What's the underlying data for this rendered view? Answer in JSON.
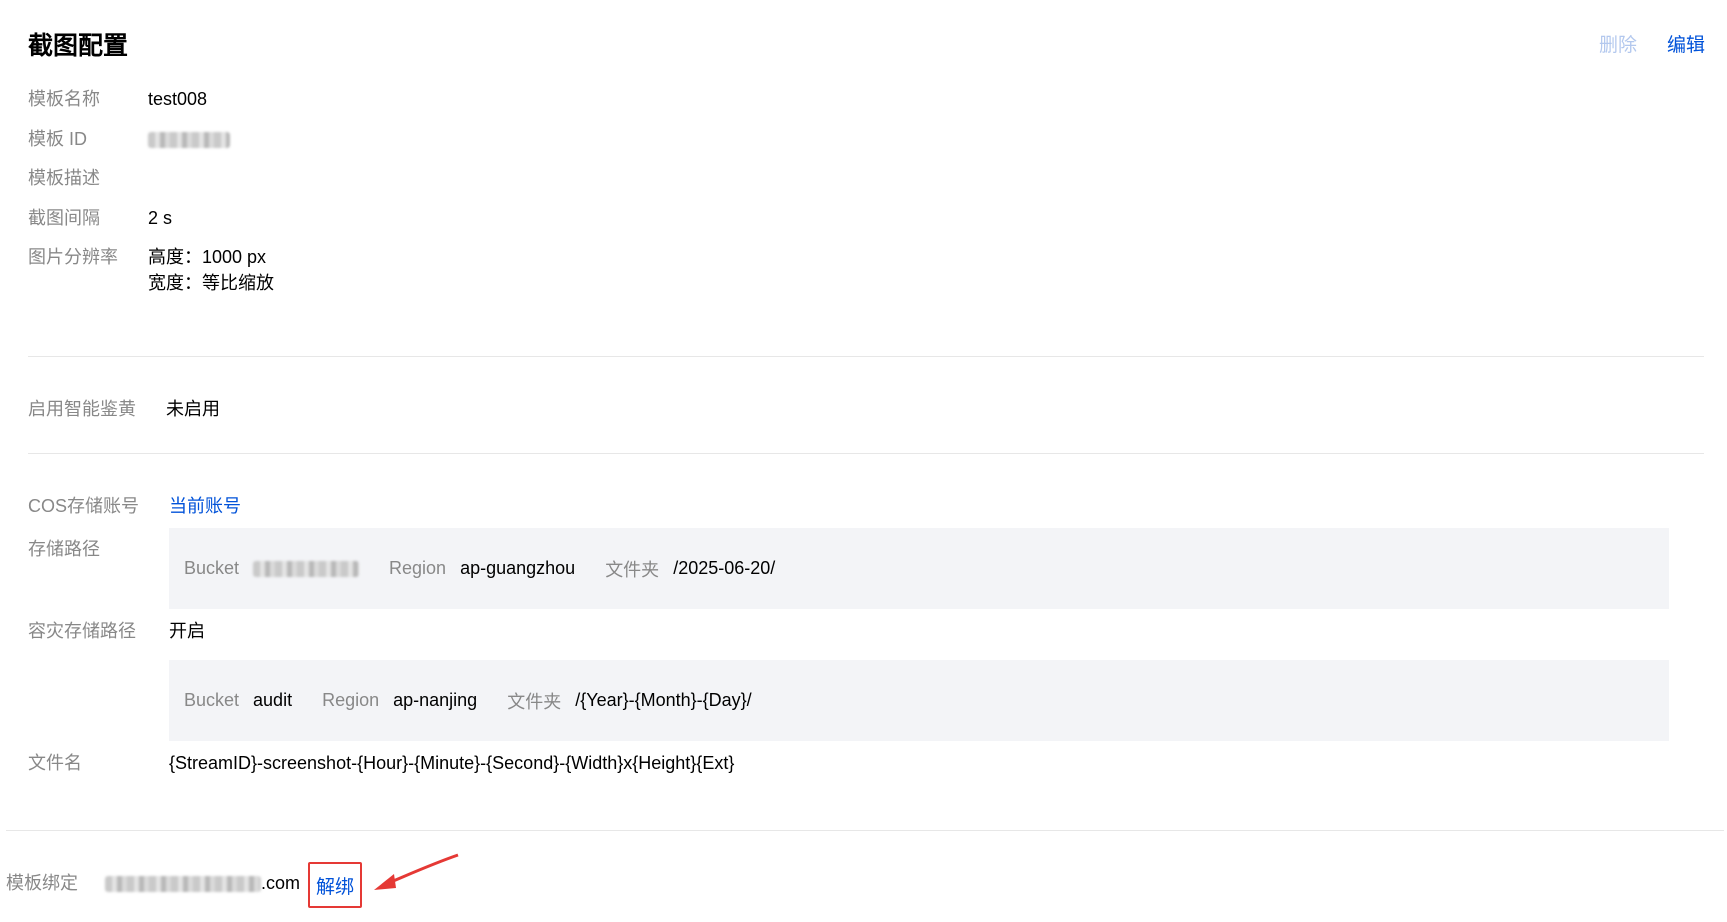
{
  "header": {
    "title": "截图配置",
    "delete_label": "删除",
    "edit_label": "编辑"
  },
  "template": {
    "name_label": "模板名称",
    "name_value": "test008",
    "id_label": "模板 ID",
    "desc_label": "模板描述",
    "desc_value": "",
    "interval_label": "截图间隔",
    "interval_value": "2 s",
    "resolution_label": "图片分辨率",
    "resolution_height": "高度：1000 px",
    "resolution_width": "宽度：等比缩放"
  },
  "porn_detect": {
    "label": "启用智能鉴黄",
    "value": "未启用"
  },
  "storage": {
    "cos_label": "COS存储账号",
    "cos_value": "当前账号",
    "path_label": "存储路径",
    "primary": {
      "bucket_label": "Bucket",
      "region_label": "Region",
      "region_value": "ap-guangzhou",
      "folder_label": "文件夹",
      "folder_value": "/2025-06-20/"
    },
    "backup_label": "容灾存储路径",
    "backup_value": "开启",
    "backup": {
      "bucket_label": "Bucket",
      "bucket_value": "audit",
      "region_label": "Region",
      "region_value": "ap-nanjing",
      "folder_label": "文件夹",
      "folder_value": "/{Year}-{Month}-{Day}/"
    },
    "filename_label": "文件名",
    "filename_value": "{StreamID}-screenshot-{Hour}-{Minute}-{Second}-{Width}x{Height}{Ext}"
  },
  "binding": {
    "label": "模板绑定",
    "domain_suffix": ".com",
    "unbind_label": "解绑"
  },
  "colors": {
    "accent": "#0052d9",
    "disabled_link": "#b3c8ee",
    "label_gray": "#888888",
    "highlight_red": "#e53935",
    "box_bg": "#f3f4f7"
  }
}
